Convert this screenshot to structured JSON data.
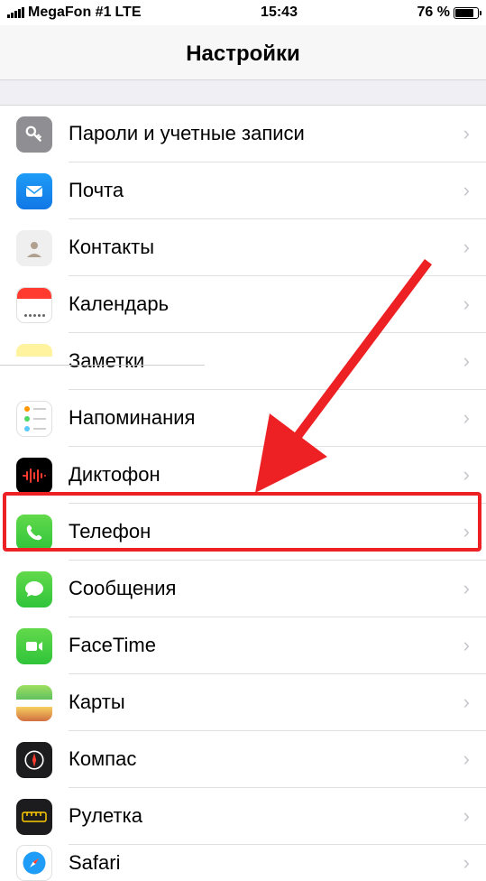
{
  "status": {
    "carrier": "MegaFon #1",
    "network": "LTE",
    "time": "15:43",
    "battery_percent": "76 %"
  },
  "title": "Настройки",
  "items": [
    {
      "id": "passwords",
      "label": "Пароли и учетные записи",
      "icon": "key-icon"
    },
    {
      "id": "mail",
      "label": "Почта",
      "icon": "mail-icon"
    },
    {
      "id": "contacts",
      "label": "Контакты",
      "icon": "contacts-icon"
    },
    {
      "id": "calendar",
      "label": "Календарь",
      "icon": "calendar-icon"
    },
    {
      "id": "notes",
      "label": "Заметки",
      "icon": "notes-icon"
    },
    {
      "id": "reminders",
      "label": "Напоминания",
      "icon": "reminders-icon"
    },
    {
      "id": "voicememo",
      "label": "Диктофон",
      "icon": "waveform-icon"
    },
    {
      "id": "phone",
      "label": "Телефон",
      "icon": "phone-icon"
    },
    {
      "id": "messages",
      "label": "Сообщения",
      "icon": "messages-icon"
    },
    {
      "id": "facetime",
      "label": "FaceTime",
      "icon": "facetime-icon"
    },
    {
      "id": "maps",
      "label": "Карты",
      "icon": "maps-icon"
    },
    {
      "id": "compass",
      "label": "Компас",
      "icon": "compass-icon"
    },
    {
      "id": "measure",
      "label": "Рулетка",
      "icon": "ruler-icon"
    },
    {
      "id": "safari",
      "label": "Safari",
      "icon": "safari-icon"
    }
  ],
  "annotation": {
    "highlighted_item": "phone",
    "has_arrow": true
  }
}
